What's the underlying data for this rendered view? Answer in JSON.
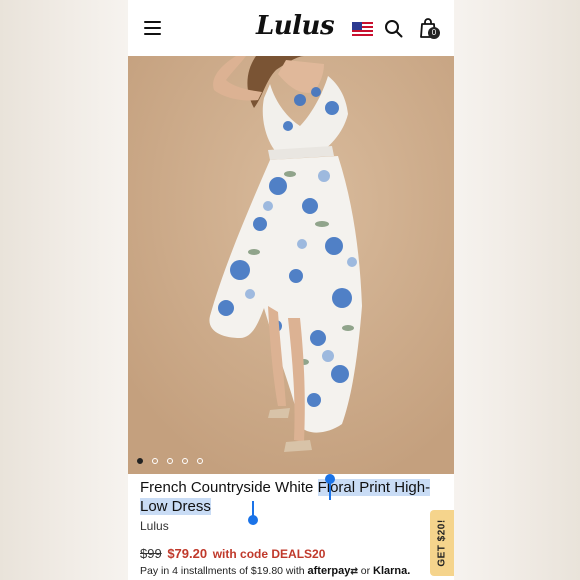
{
  "header": {
    "logo_text": "Lulus",
    "menu_icon": "hamburger-menu-icon",
    "flag_icon": "us-flag-icon",
    "search_icon": "search-icon",
    "bag_icon": "shopping-bag-icon",
    "bag_count": "0"
  },
  "gallery": {
    "image_description": "model in white floral print high-low dress",
    "dots": [
      {
        "active": true
      },
      {
        "active": false
      },
      {
        "active": false
      },
      {
        "active": false
      },
      {
        "active": false
      }
    ]
  },
  "product": {
    "title_part1": "French Countryside White ",
    "title_part2": "Floral Print High-Low Dress",
    "brand": "Lulus",
    "old_price": "$99",
    "new_price": "$79.20",
    "promo": "with code DEALS20",
    "installments_text": "Pay in 4 installments of $19.80 with ",
    "afterpay": "afterpay",
    "or_text": " or ",
    "klarna": "Klarna."
  },
  "promo_tab": {
    "label": "GET $20!"
  },
  "colors": {
    "price_red": "#c0392b",
    "selection": "#c9dcf5",
    "selection_handle": "#1a73e8",
    "promo_tab": "#f5d48c"
  }
}
